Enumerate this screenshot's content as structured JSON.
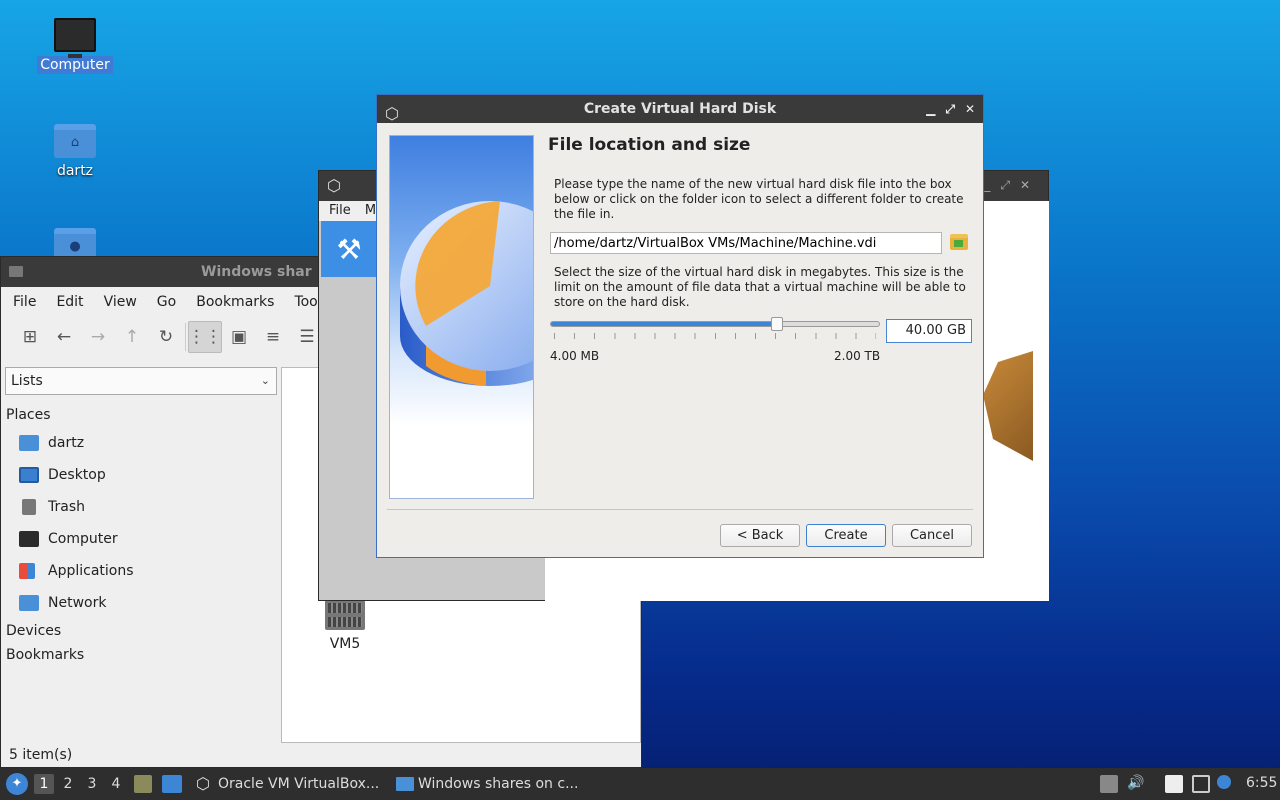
{
  "desktop": {
    "icons": [
      {
        "label": "Computer"
      },
      {
        "label": "dartz"
      }
    ]
  },
  "file_manager": {
    "title": "Windows shar",
    "menu": [
      "File",
      "Edit",
      "View",
      "Go",
      "Bookmarks",
      "Too"
    ],
    "side_pane_select": "Lists",
    "sections": {
      "places": "Places",
      "devices": "Devices",
      "bookmarks": "Bookmarks"
    },
    "places": [
      {
        "label": "dartz",
        "icon": "home-folder-icon"
      },
      {
        "label": "Desktop",
        "icon": "desktop-icon"
      },
      {
        "label": "Trash",
        "icon": "trash-icon"
      },
      {
        "label": "Computer",
        "icon": "computer-icon"
      },
      {
        "label": "Applications",
        "icon": "applications-icon"
      },
      {
        "label": "Network",
        "icon": "network-icon"
      }
    ],
    "content_items": [
      {
        "label": "VM5"
      }
    ],
    "status": "5 item(s)"
  },
  "vbox_manager": {
    "menu": [
      "File",
      "M"
    ]
  },
  "dialog": {
    "title": "Create Virtual Hard Disk",
    "heading": "File location and size",
    "location_text": "Please type the name of the new virtual hard disk file into the box below or click on the folder icon to select a different folder to create the file in.",
    "location_value": "/home/dartz/VirtualBox VMs/Machine/Machine.vdi",
    "size_text": "Select the size of the virtual hard disk in megabytes. This size is the limit on the amount of file data that a virtual machine will be able to store on the hard disk.",
    "size_value": "40.00 GB",
    "slider_fraction": 0.69,
    "min_label": "4.00 MB",
    "max_label": "2.00 TB",
    "buttons": {
      "back": "< Back",
      "create": "Create",
      "cancel": "Cancel"
    }
  },
  "taskbar": {
    "workspaces": [
      "1",
      "2",
      "3",
      "4"
    ],
    "active_workspace": "1",
    "tasks": [
      {
        "label": "Oracle VM VirtualBox..."
      },
      {
        "label": "Windows shares on c..."
      }
    ],
    "clock": "6:55"
  },
  "colors": {
    "accent": "#3d86d6",
    "titlebar": "#3a3a3a",
    "taskbar": "#2e2e2e"
  }
}
